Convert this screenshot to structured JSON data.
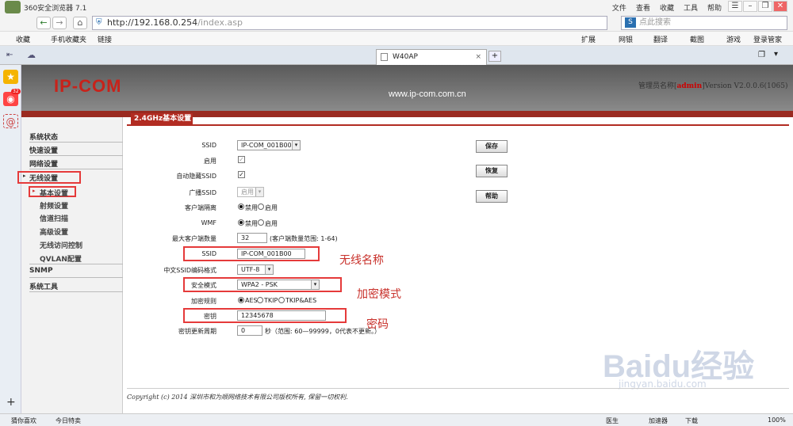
{
  "browser": {
    "title": "360安全浏览器 7.1",
    "menus": [
      "文件",
      "查看",
      "收藏",
      "工具",
      "帮助"
    ],
    "url_host": "http://192.168.0.254",
    "url_path": "/index.asp",
    "search_placeholder": "点此搜索",
    "favorites": {
      "fav": "收藏",
      "mobile": "手机收藏夹",
      "link": "链接",
      "ext": "扩展",
      "bank": "网银",
      "translate": "翻译",
      "screenshot": "截图",
      "game": "游戏",
      "login": "登录管家"
    },
    "tab_title": "W40AP",
    "badge_count": "32"
  },
  "router": {
    "logo": "IP-COM",
    "domain": "www.ip-com.com.cn",
    "admin_label": "管理员名称",
    "admin_name": "admin",
    "version": "Version V2.0.0.6(1065)",
    "menu": [
      {
        "label": "系统状态"
      },
      {
        "label": "快速设置"
      },
      {
        "label": "网络设置"
      },
      {
        "label": "无线设置"
      }
    ],
    "submenu": [
      "基本设置",
      "射频设置",
      "信道扫描",
      "高级设置",
      "无线访问控制",
      "QVLAN配置"
    ],
    "menu_bottom": [
      "SNMP",
      "系统工具"
    ],
    "section_title": "2.4GHz基本设置",
    "fields": {
      "ssid_select_label": "SSID",
      "ssid_select_value": "IP-COM_001B00",
      "enable_label": "启用",
      "hide_ssid_label": "自动隐藏SSID",
      "broadcast_label": "广播SSID",
      "broadcast_value": "启用",
      "isolation_label": "客户端隔离",
      "wmf_label": "WMF",
      "disable": "禁用",
      "enable": "启用",
      "max_clients_label": "最大客户端数量",
      "max_clients_value": "32",
      "max_clients_hint": "(客户端数量范围: 1-64)",
      "ssid_label": "SSID",
      "ssid_value": "IP-COM_001B00",
      "encoding_label": "中文SSID编码格式",
      "encoding_value": "UTF-8",
      "security_label": "安全模式",
      "security_value": "WPA2 - PSK",
      "cipher_label": "加密规则",
      "cipher_options": [
        "AES",
        "TKIP",
        "TKIP&AES"
      ],
      "key_label": "密钥",
      "key_value": "12345678",
      "renew_label": "密钥更新周期",
      "renew_value": "0",
      "renew_hint": "秒（范围: 60—99999，0代表不更新。）"
    },
    "buttons": {
      "save": "保存",
      "restore": "恢复",
      "help": "帮助"
    },
    "annotations": {
      "ssid": "无线名称",
      "security": "加密模式",
      "key": "密码"
    },
    "footer": "Copyright (c) 2014 深圳市和为顺网络技术有限公司版权所有, 保留一切权利."
  },
  "statusbar": {
    "left1": "猜你喜欢",
    "left2": "今日特卖",
    "doctor": "医生",
    "speedup": "加速器",
    "download": "下载",
    "zoom": "100%"
  },
  "watermark": {
    "main": "Baidu经验",
    "sub": "jingyan.baidu.com"
  }
}
